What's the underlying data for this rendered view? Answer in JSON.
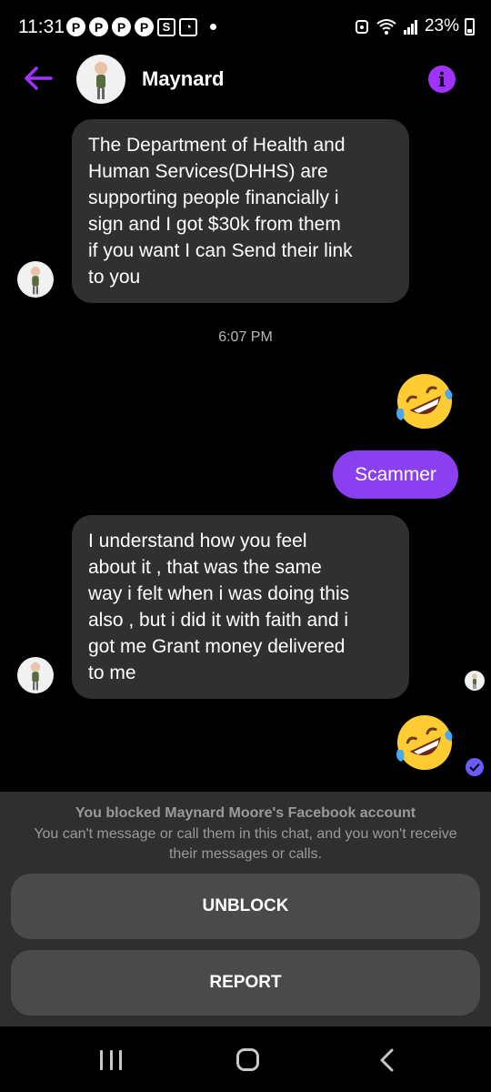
{
  "status_bar": {
    "time": "11:31",
    "notification_icons": [
      "pinterest-icon",
      "pinterest-icon",
      "pinterest-icon",
      "pinterest-icon",
      "s-app-icon",
      "app-icon"
    ],
    "battery": "23%"
  },
  "header": {
    "contact_name": "Maynard",
    "accent_color": "#a033ff"
  },
  "messages": {
    "first_incoming": {
      "lines": [
        "The Department of Health and",
        "Human Services(DHHS) are",
        "supporting people financially i",
        "sign and I got $30k  from them",
        "if you want I can Send their link",
        "to you"
      ]
    },
    "timestamp": "6:07 PM",
    "outgoing_emoji_1": "rolling-on-floor-laughing-emoji",
    "outgoing_text": "Scammer",
    "second_incoming": {
      "lines": [
        "I understand how you feel",
        "about it , that was the same",
        "way i felt when i was doing this",
        "also , but i did it with faith and i",
        "got me Grant money delivered",
        "to me"
      ]
    },
    "outgoing_emoji_2": "rolling-on-floor-laughing-emoji",
    "outgoing_bubble_color": "#8a3ff0"
  },
  "blocked_panel": {
    "title": "You blocked Maynard Moore's Facebook account",
    "subtitle": "You can't message or call them in this chat, and you won't receive their messages or calls.",
    "unblock_label": "UNBLOCK",
    "report_label": "REPORT"
  }
}
